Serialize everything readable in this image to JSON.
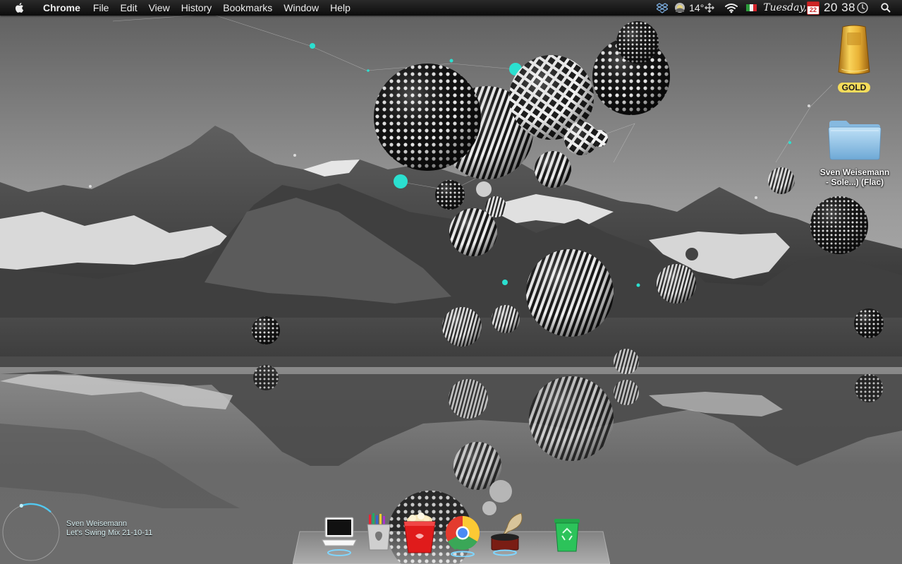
{
  "menubar": {
    "app_name": "Chrome",
    "menus": [
      "File",
      "Edit",
      "View",
      "History",
      "Bookmarks",
      "Window",
      "Help"
    ],
    "status": {
      "weather_temp": "14°",
      "day": "Tuesday,",
      "calendar_date": "22",
      "time": "20 38"
    },
    "icons": {
      "apple": "apple-logo-icon",
      "dropbox": "dropbox-icon",
      "weather": "weather-icon",
      "network": "network-arrows-icon",
      "wifi": "wifi-icon",
      "flag": "italy-flag-icon",
      "calendar": "calendar-icon",
      "clock": "clock-icon",
      "spotlight": "spotlight-search-icon"
    }
  },
  "desktop": {
    "icons": [
      {
        "label": "GOLD",
        "icon": "gold-bar-icon"
      },
      {
        "label_line1": "Sven Weisemann",
        "label_line2": "- Sole...) (Flac)",
        "icon": "folder-icon"
      }
    ]
  },
  "now_playing": {
    "artist": "Sven Weisemann",
    "track": "Let's Swing Mix 21-10-11",
    "progress": 0.12
  },
  "dock": {
    "items": [
      {
        "name": "macbook",
        "icon": "laptop-icon"
      },
      {
        "name": "pencil-cup",
        "icon": "pencil-cup-icon"
      },
      {
        "name": "popcorn",
        "icon": "popcorn-icon"
      },
      {
        "name": "chrome",
        "icon": "chrome-icon"
      },
      {
        "name": "gramophone",
        "icon": "gramophone-icon"
      },
      {
        "name": "trash",
        "icon": "trash-icon"
      }
    ]
  },
  "colors": {
    "menubar": "#111111",
    "accent_cyan": "#2be0d0",
    "gold_label": "#f5dc5b",
    "folder_blue": "#8ec6ea"
  }
}
